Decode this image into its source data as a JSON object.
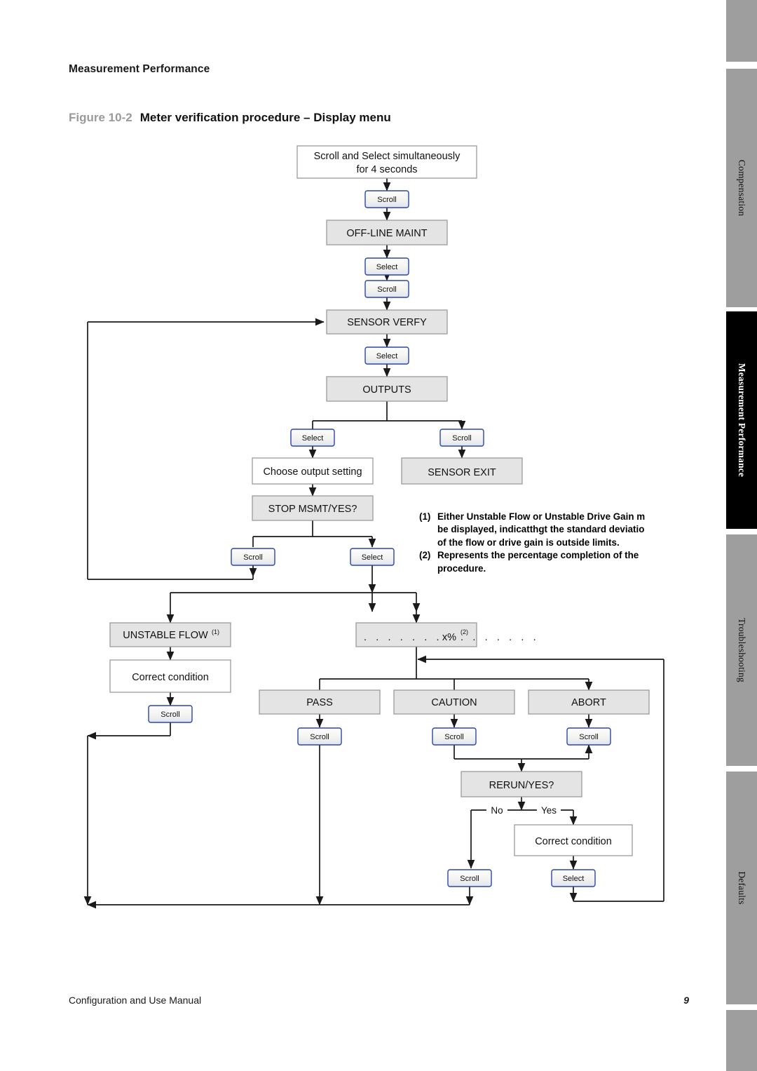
{
  "page": {
    "running_head": "Measurement Performance",
    "figure_number": "Figure 10-2",
    "figure_title": "Meter verification procedure – Display menu",
    "footer_left": "Configuration and Use Manual",
    "footer_page": "9"
  },
  "tabs": [
    {
      "label": "",
      "active": false
    },
    {
      "label": "Compensation",
      "active": false
    },
    {
      "label": "Measurement Performance",
      "active": true
    },
    {
      "label": "Troubleshooting",
      "active": false
    },
    {
      "label": "Defaults",
      "active": false
    },
    {
      "label": "",
      "active": false
    }
  ],
  "footnotes": [
    {
      "mark": "(1)",
      "lines": [
        "Either Unstable Flow or Unstable Drive Gain m",
        "be displayed, indicatthgt the standard deviatio",
        "of the flow or drive gain is outside limits."
      ]
    },
    {
      "mark": "(2)",
      "lines": [
        "Represents the percentage completion of the",
        "procedure."
      ]
    }
  ],
  "flow": {
    "nodes": {
      "start": {
        "text": "Scroll  and Select  simultaneously",
        "text2": "for 4 seconds"
      },
      "offline_maint": {
        "text": "OFF-LINE MAINT"
      },
      "sensor_verfy": {
        "text": "SENSOR VERFY"
      },
      "outputs": {
        "text": "OUTPUTS"
      },
      "choose_output": {
        "text": "Choose output setting"
      },
      "sensor_exit": {
        "text": "SENSOR EXIT"
      },
      "stop_msmt": {
        "text": "STOP MSMT/YES?"
      },
      "unstable_flow": {
        "text": "UNSTABLE FLOW",
        "sup": "(1)"
      },
      "progress": {
        "dots": ". . . . . . . . . . . . . . .",
        "text": "x%",
        "sup": "(2)"
      },
      "correct_cond_1": {
        "text": "Correct condition"
      },
      "pass": {
        "text": "PASS"
      },
      "caution": {
        "text": "CAUTION"
      },
      "abort": {
        "text": "ABORT"
      },
      "rerun": {
        "text": "RERUN/YES?"
      },
      "correct_cond_2": {
        "text": "Correct condition"
      }
    },
    "buttons": {
      "b_start_scroll": {
        "text": "Scroll"
      },
      "b_maint_select": {
        "text": "Select"
      },
      "b_maint_scroll": {
        "text": "Scroll"
      },
      "b_verfy_select": {
        "text": "Select"
      },
      "b_outputs_select": {
        "text": "Select"
      },
      "b_outputs_scroll": {
        "text": "Scroll"
      },
      "b_stop_scroll": {
        "text": "Scroll"
      },
      "b_stop_select": {
        "text": "Select"
      },
      "b_correct1_scroll": {
        "text": "Scroll"
      },
      "b_pass_scroll": {
        "text": "Scroll"
      },
      "b_caution_scroll": {
        "text": "Scroll"
      },
      "b_abort_scroll": {
        "text": "Scroll"
      },
      "b_rerun_no_scroll": {
        "text": "Scroll"
      },
      "b_rerun_select": {
        "text": "Select"
      }
    },
    "edge_labels": {
      "rerun_no": "No",
      "rerun_yes": "Yes"
    },
    "colors": {
      "menu_fill": "#e4e4e4",
      "plain_fill": "#ffffff",
      "button_stroke": "#2b46a8",
      "line": "#1a1a1a"
    }
  }
}
